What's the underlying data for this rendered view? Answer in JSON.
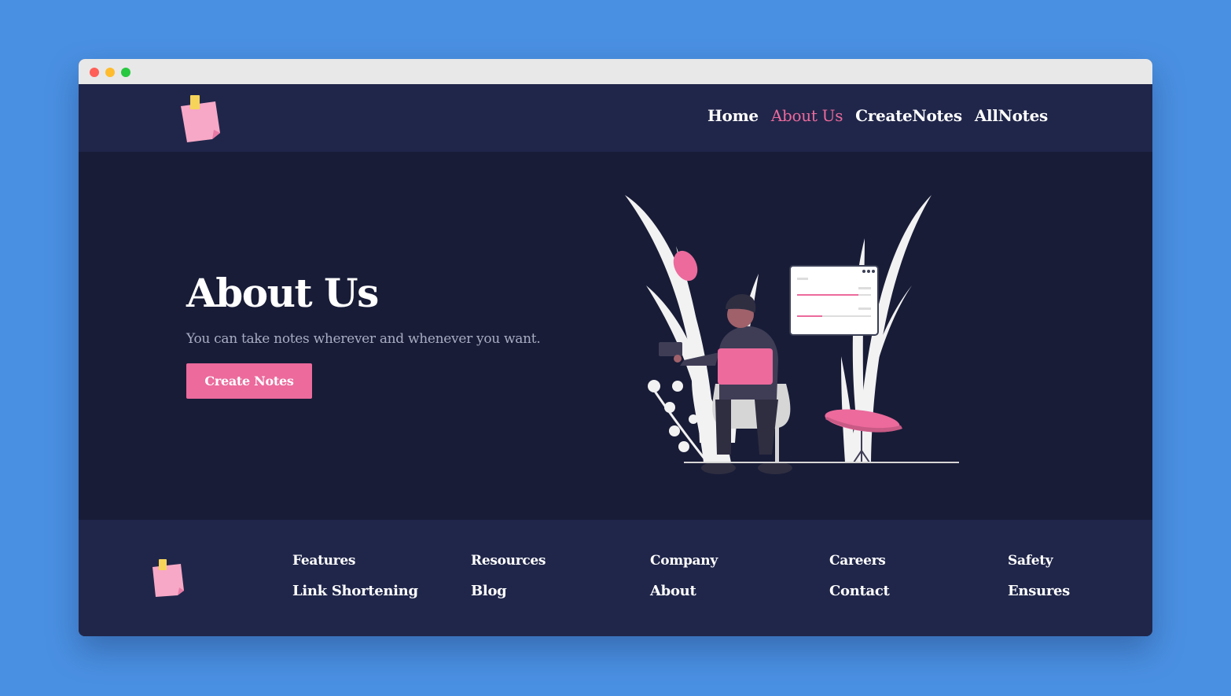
{
  "nav": {
    "items": [
      {
        "label": "Home",
        "active": false
      },
      {
        "label": "About Us",
        "active": true
      },
      {
        "label": "CreateNotes",
        "active": false
      },
      {
        "label": "AllNotes",
        "active": false
      }
    ]
  },
  "hero": {
    "title": "About Us",
    "subtitle": "You can take notes wherever and whenever you want.",
    "cta_label": "Create Notes"
  },
  "footer": {
    "columns": [
      {
        "heading": "Features",
        "link": "Link Shortening"
      },
      {
        "heading": "Resources",
        "link": "Blog"
      },
      {
        "heading": "Company",
        "link": "About"
      },
      {
        "heading": "Careers",
        "link": "Contact"
      },
      {
        "heading": "Safety",
        "link": "Ensures"
      }
    ]
  },
  "colors": {
    "accent": "#ec6a9c",
    "nav_bg": "#20264a",
    "hero_bg": "#181c37",
    "desktop_bg": "#4a90e2"
  },
  "icons": {
    "logo": "sticky-note-icon",
    "illustration": "person-with-laptop-illustration"
  }
}
